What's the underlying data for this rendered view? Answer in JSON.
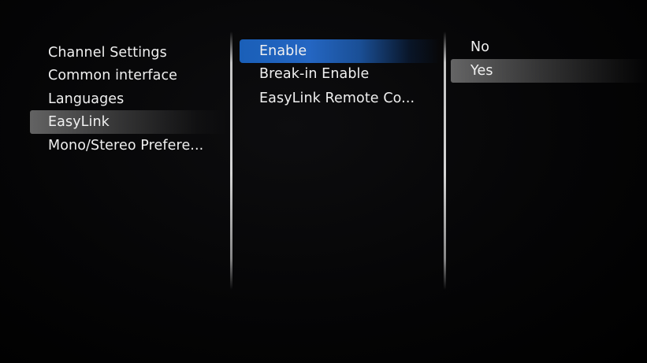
{
  "menu": {
    "left": {
      "items": [
        {
          "label": "Channel Settings"
        },
        {
          "label": "Common interface"
        },
        {
          "label": "Languages"
        },
        {
          "label": "EasyLink"
        },
        {
          "label": "Mono/Stereo Prefere..."
        }
      ],
      "selected_label": "EasyLink"
    },
    "middle": {
      "items": [
        {
          "label": "Enable"
        },
        {
          "label": "Break-in Enable"
        },
        {
          "label": "EasyLink Remote Co..."
        }
      ],
      "focused_label": "Enable"
    },
    "right": {
      "items": [
        {
          "label": "No"
        },
        {
          "label": "Yes"
        }
      ],
      "selected_label": "Yes"
    }
  },
  "colors": {
    "background": "#000000",
    "focus_highlight": "#2466c2",
    "selection_highlight": "#8c8c8c",
    "text": "#f0f0f0"
  }
}
